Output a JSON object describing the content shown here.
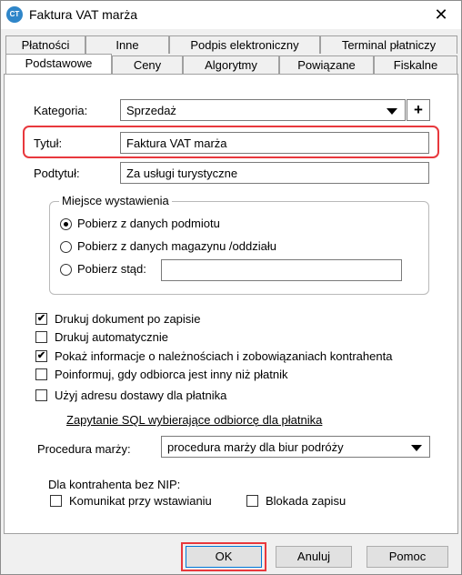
{
  "window": {
    "title": "Faktura VAT marża",
    "app_icon_text": "CT",
    "close_glyph": "✕"
  },
  "tabs_row1": [
    {
      "label": "Płatności"
    },
    {
      "label": "Inne"
    },
    {
      "label": "Podpis elektroniczny"
    },
    {
      "label": "Terminal płatniczy"
    }
  ],
  "tabs_row2": [
    {
      "label": "Podstawowe",
      "active": true
    },
    {
      "label": "Ceny"
    },
    {
      "label": "Algorytmy"
    },
    {
      "label": "Powiązane"
    },
    {
      "label": "Fiskalne"
    }
  ],
  "form": {
    "kategoria_label": "Kategoria:",
    "kategoria_value": "Sprzedaż",
    "plus_label": "+",
    "tytul_label": "Tytuł:",
    "tytul_value": "Faktura VAT marża",
    "podtytul_label": "Podtytuł:",
    "podtytul_value": "Za usługi turystyczne"
  },
  "miejsce": {
    "title": "Miejsce wystawienia",
    "options": [
      {
        "label": "Pobierz z danych podmiotu",
        "checked": true
      },
      {
        "label": "Pobierz z danych magazynu /oddziału",
        "checked": false
      },
      {
        "label": "Pobierz stąd:",
        "checked": false
      }
    ],
    "stad_value": ""
  },
  "checkboxes": [
    {
      "label": "Drukuj dokument po zapisie",
      "checked": true
    },
    {
      "label": "Drukuj automatycznie",
      "checked": false
    },
    {
      "label": "Pokaż informacje o należnościach i zobowiązaniach kontrahenta",
      "checked": true
    },
    {
      "label": "Poinformuj, gdy odbiorca jest inny niż płatnik",
      "checked": false
    },
    {
      "label": "Użyj adresu dostawy dla płatnika",
      "checked": false
    }
  ],
  "check_glyph": "✔",
  "sql_link": "Zapytanie SQL wybierające odbiorcę dla płatnika",
  "procedura": {
    "label": "Procedura marży:",
    "value": "procedura marży dla biur podróży"
  },
  "nip": {
    "title": "Dla kontrahenta bez NIP:",
    "komunikat": {
      "label": "Komunikat przy wstawianiu",
      "checked": false
    },
    "blokada": {
      "label": "Blokada zapisu",
      "checked": false
    }
  },
  "buttons": {
    "ok": "OK",
    "anuluj": "Anuluj",
    "pomoc": "Pomoc"
  },
  "colors": {
    "highlight": "#e8383d",
    "default_button_border": "#0078d7"
  }
}
